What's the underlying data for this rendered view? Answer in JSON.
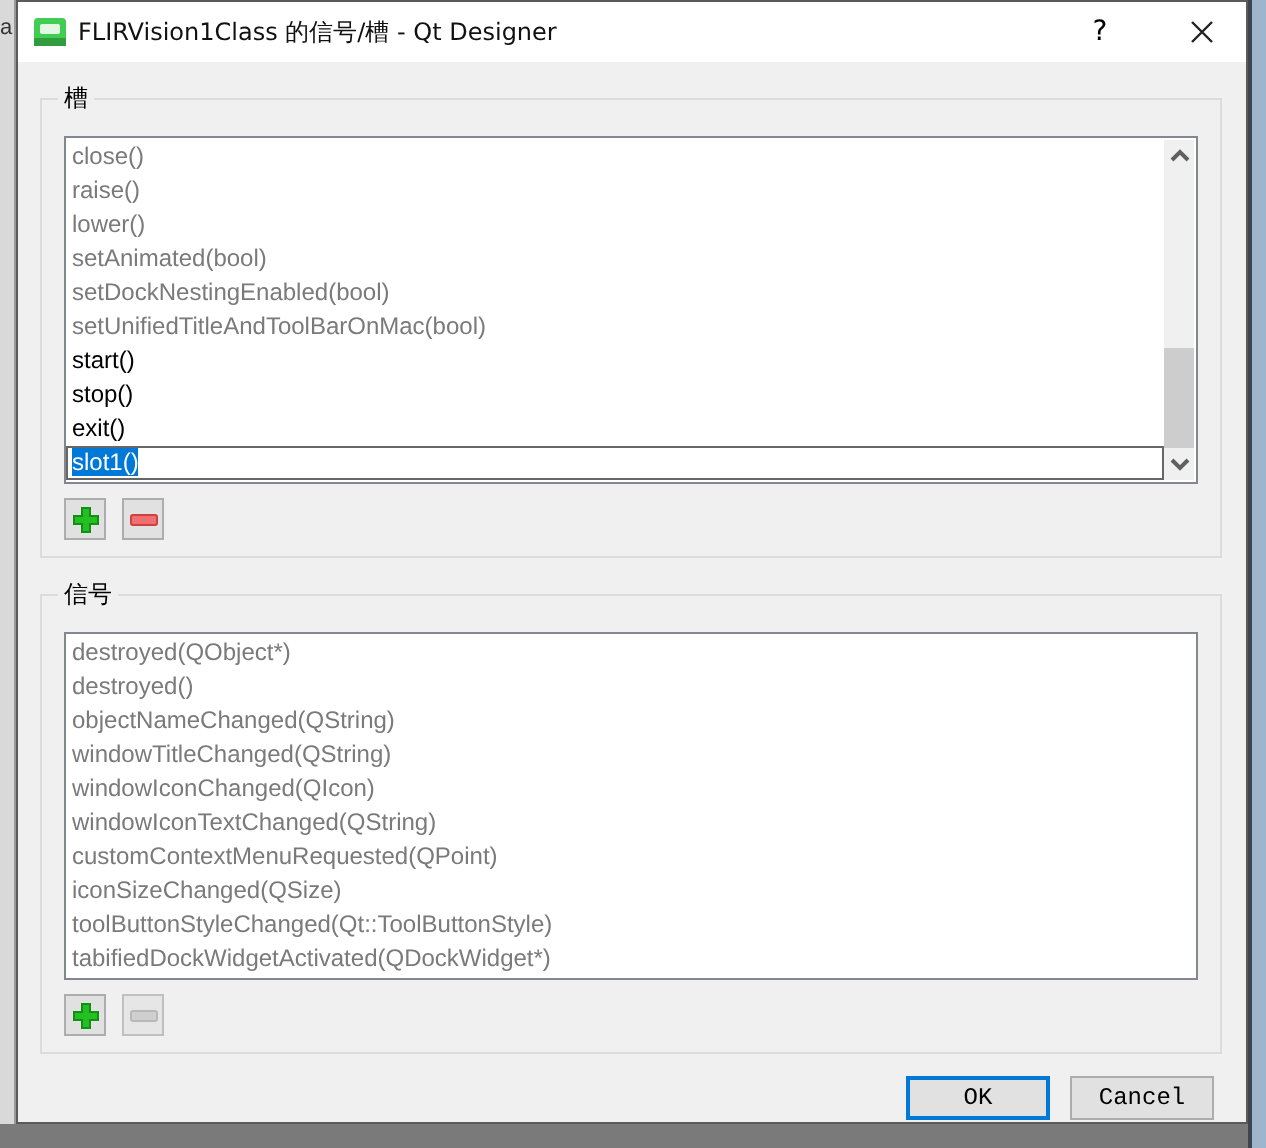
{
  "background_window": {
    "text": "a"
  },
  "window": {
    "title": "FLIRVision1Class 的信号/槽 - Qt Designer",
    "help_button": "?"
  },
  "slots": {
    "title": "槽",
    "items": [
      {
        "text": "close()",
        "inherited": true,
        "kind": "item"
      },
      {
        "text": "raise()",
        "inherited": true,
        "kind": "item"
      },
      {
        "text": "lower()",
        "inherited": true,
        "kind": "item"
      },
      {
        "text": "setAnimated(bool)",
        "inherited": true,
        "kind": "item"
      },
      {
        "text": "setDockNestingEnabled(bool)",
        "inherited": true,
        "kind": "item"
      },
      {
        "text": "setUnifiedTitleAndToolBarOnMac(bool)",
        "inherited": true,
        "kind": "item"
      },
      {
        "text": "start()",
        "inherited": false,
        "kind": "item"
      },
      {
        "text": "stop()",
        "inherited": false,
        "kind": "item"
      },
      {
        "text": "exit()",
        "inherited": false,
        "kind": "item"
      },
      {
        "text": "slot1()",
        "inherited": false,
        "kind": "editor"
      }
    ],
    "scrollbar": true,
    "add_disabled": false,
    "remove_disabled": false
  },
  "signals": {
    "title": "信号",
    "items": [
      {
        "text": "destroyed(QObject*)",
        "inherited": true,
        "kind": "item"
      },
      {
        "text": "destroyed()",
        "inherited": true,
        "kind": "item"
      },
      {
        "text": "objectNameChanged(QString)",
        "inherited": true,
        "kind": "item"
      },
      {
        "text": "windowTitleChanged(QString)",
        "inherited": true,
        "kind": "item"
      },
      {
        "text": "windowIconChanged(QIcon)",
        "inherited": true,
        "kind": "item"
      },
      {
        "text": "windowIconTextChanged(QString)",
        "inherited": true,
        "kind": "item"
      },
      {
        "text": "customContextMenuRequested(QPoint)",
        "inherited": true,
        "kind": "item"
      },
      {
        "text": "iconSizeChanged(QSize)",
        "inherited": true,
        "kind": "item"
      },
      {
        "text": "toolButtonStyleChanged(Qt::ToolButtonStyle)",
        "inherited": true,
        "kind": "item"
      },
      {
        "text": "tabifiedDockWidgetActivated(QDockWidget*)",
        "inherited": true,
        "kind": "item"
      }
    ],
    "scrollbar": false,
    "add_disabled": false,
    "remove_disabled": true
  },
  "buttons": [
    {
      "label": "OK",
      "default": true
    },
    {
      "label": "Cancel",
      "default": false
    }
  ]
}
